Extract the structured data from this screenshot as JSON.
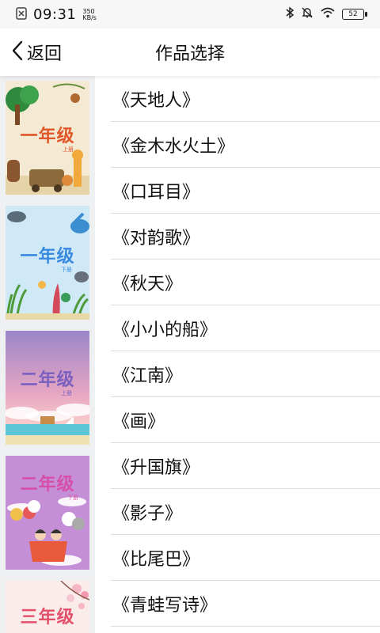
{
  "status_bar": {
    "time": "09:31",
    "speed_value": "350",
    "speed_unit": "KB/s",
    "battery": "52"
  },
  "header": {
    "back_label": "返回",
    "title": "作品选择"
  },
  "covers": [
    {
      "label": "一年级",
      "sublabel": "上册",
      "theme": "animals"
    },
    {
      "label": "一年级",
      "sublabel": "下册",
      "theme": "ocean"
    },
    {
      "label": "二年级",
      "sublabel": "上册",
      "theme": "sunset"
    },
    {
      "label": "二年级",
      "sublabel": "下册",
      "theme": "balloon"
    },
    {
      "label": "三年级",
      "sublabel": "",
      "theme": "blossom"
    }
  ],
  "works": [
    "《天地人》",
    "《金木水火土》",
    "《口耳目》",
    "《对韵歌》",
    "《秋天》",
    "《小小的船》",
    "《江南》",
    "《画》",
    "《升国旗》",
    "《影子》",
    "《比尾巴》",
    "《青蛙写诗》"
  ]
}
